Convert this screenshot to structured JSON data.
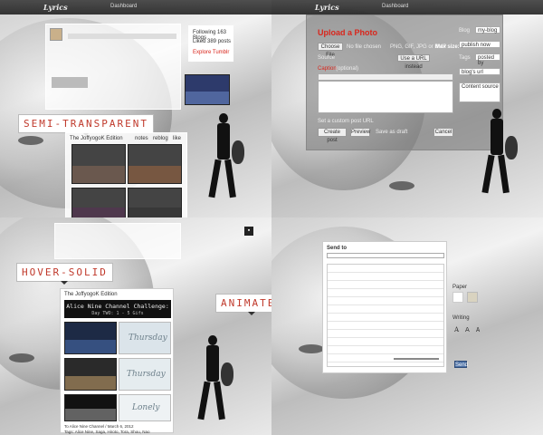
{
  "header": {
    "logo": "Lyrics",
    "dashboard": "Dashboard"
  },
  "labels": {
    "semi_transparent": "SEMI-TRANSPARENT",
    "hover_solid": "HOVER-SOLID",
    "animated": "ANIMATED"
  },
  "q1": {
    "sidebar": {
      "following": "Following 163 Blogs",
      "liked": "Liked 389 posts",
      "explore": "Explore Tumblr"
    },
    "post_header": "The JoffyogoK Edition",
    "post_actions": {
      "notes": "notes",
      "reblog": "reblog",
      "like": "like"
    }
  },
  "q2": {
    "upload_title": "Upload a Photo",
    "choose_file": "Choose File",
    "no_file": "No file chosen",
    "formats": "PNG, GIF, JPG or BMP",
    "max_size": "Max size: 10 MB",
    "source": "Source",
    "use_url": "Use a URL instead",
    "caption_label": "Caption",
    "optional": "(optional)",
    "set_custom": "Set a custom post URL",
    "create_post": "Create post",
    "preview": "Preview",
    "save_draft": "Save as draft",
    "cancel": "Cancel",
    "side": {
      "blog": "Blog",
      "blog_value": "my-blog",
      "publishing": "publish now",
      "tags": "Tags",
      "tags_value": "posted by",
      "url": "blog's url",
      "content_source": "Content source"
    }
  },
  "q3": {
    "post_header": "The JoffyogoK Edition",
    "challenge_title": "Alice Nine Channel Challenge:",
    "challenge_sub": "Day TWO: 1 - 5 Gifs",
    "hand1": "Thursday",
    "hand2": "Thursday",
    "hand3": "Lonely",
    "footer": "To Alice Nine Channel / March 6, 2012",
    "tags": "Tags: Alice Nine, Saga, Hiroto, Tora, Shou, Nao"
  },
  "q4": {
    "send_to": "Send to",
    "paper": "Paper",
    "writing": "Writing",
    "fonts": [
      "A",
      "A",
      "A"
    ],
    "send": "Send"
  }
}
